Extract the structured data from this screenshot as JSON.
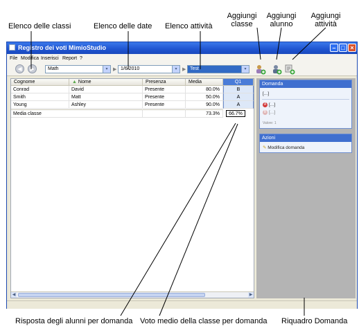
{
  "callouts": {
    "elenco_classi": "Elenco delle classi",
    "elenco_date": "Elenco delle date",
    "elenco_attivita": "Elenco attività",
    "aggiungi_classe_1": "Aggiungi",
    "aggiungi_classe_2": "classe",
    "aggiungi_alunno_1": "Aggiungi",
    "aggiungi_alunno_2": "alunno",
    "aggiungi_attivita_1": "Aggiungi",
    "aggiungi_attivita_2": "attività",
    "risposta_alunni": "Risposta degli alunni per domanda",
    "voto_medio": "Voto medio della classe per domanda",
    "riquadro_domanda": "Riquadro Domanda"
  },
  "window": {
    "title": "Registro dei voti MimioStudio",
    "min": "–",
    "max": "□",
    "close": "×"
  },
  "menu": [
    "File",
    "Modifica",
    "Inserisci",
    "Report",
    "?"
  ],
  "toolbar": {
    "back": "◀",
    "forward": "▶",
    "class_value": "Math",
    "date_value": "1/6/2010",
    "activity_value": "Test",
    "dropdown_arrow": "▾",
    "separator": "▶"
  },
  "table": {
    "headers": {
      "cognome": "Cognome",
      "nome": "Nome",
      "presenza": "Presenza",
      "media": "Media",
      "q1": "Q1"
    },
    "sort_indicator": "▲",
    "rows": [
      {
        "cognome": "Conrad",
        "nome": "David",
        "presenza": "Presente",
        "media": "80.0%",
        "q1": "B"
      },
      {
        "cognome": "Smith",
        "nome": "Matt",
        "presenza": "Presente",
        "media": "50.0%",
        "q1": "A"
      },
      {
        "cognome": "Young",
        "nome": "Ashley",
        "presenza": "Presente",
        "media": "90.0%",
        "q1": "A"
      }
    ],
    "summary": {
      "label": "Media classe",
      "media": "73.3%",
      "q1": "66.7%"
    },
    "scroll_left": "◀",
    "scroll_right": "▶"
  },
  "question_pane": {
    "title": "Domanda",
    "question_text": "[...]",
    "answer_a_badge": "A",
    "answer_a_text": "[...]",
    "answer_b_badge": "B",
    "answer_b_text": "[...]",
    "value_text": "Valore: 1"
  },
  "actions_pane": {
    "title": "Azioni",
    "edit_question": "Modifica domanda"
  }
}
